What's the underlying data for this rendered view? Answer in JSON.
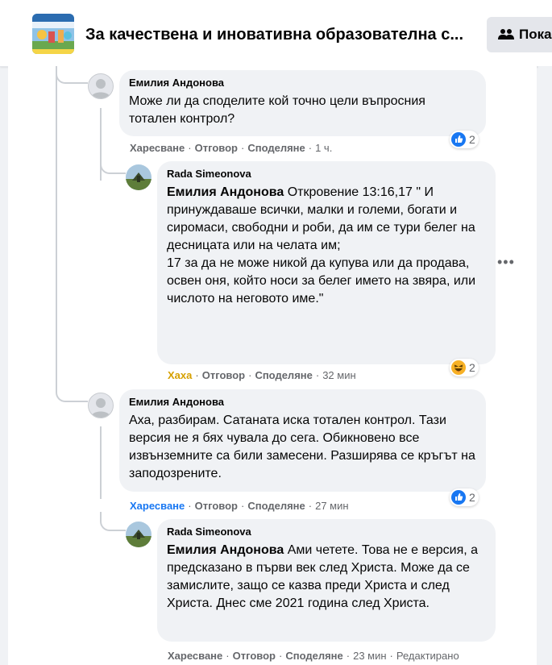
{
  "header": {
    "group_title": "За качествена и иновативна образователна с...",
    "invite_label": "Покани"
  },
  "comments": [
    {
      "author": "Емилия Андонова",
      "text": "Може ли да споделите кой точно цели въпросния тотален контрол?",
      "actions": {
        "like": "Харесване",
        "reply": "Отговор",
        "share": "Споделяне",
        "time": "1 ч."
      },
      "reaction_count": "2"
    },
    {
      "author": "Rada Simeonova",
      "mention": "Емилия Андонова",
      "text": "Откровение 13:16,17 \" И принуждаваше всички, малки и големи, богати и сиромаси, свободни и роби, да им се тури белег на десницата или на челата им;",
      "text2": "17 за да не може никой да купува или да продава, освен оня, който носи за белег името на звяра, или числото на неговото име.\"",
      "actions": {
        "like": "Хаха",
        "reply": "Отговор",
        "share": "Споделяне",
        "time": "32 мин"
      },
      "reaction_count": "2"
    },
    {
      "author": "Емилия Андонова",
      "text": "Аха, разбирам. Сатаната иска тотален контрол. Тази версия не я бях чувала до сега. Обикновено все извънземните са били замесени. Разширява се кръгът на заподозрените.",
      "actions": {
        "like": "Харесване",
        "reply": "Отговор",
        "share": "Споделяне",
        "time": "27 мин"
      },
      "reaction_count": "2"
    },
    {
      "author": "Rada Simeonova",
      "mention": "Емилия Андонова",
      "text": "Ами четете. Това не е версия, а предсказано в първи век след Христа. Може да се замислите, защо се казва преди Христа и след Христа. Днес сме 2021 година след Христа.",
      "actions": {
        "like": "Харесване",
        "reply": "Отговор",
        "share": "Споделяне",
        "time": "23 мин",
        "edited": "Редактирано"
      }
    }
  ],
  "colors": {
    "like_blue": "#1877f2",
    "haha_yellow": "#d6a000",
    "bubble": "#f0f2f5"
  },
  "icons": {
    "invite": "people-icon",
    "like": "like-reaction-icon",
    "haha": "haha-reaction-icon",
    "more": "more-dots-icon"
  }
}
